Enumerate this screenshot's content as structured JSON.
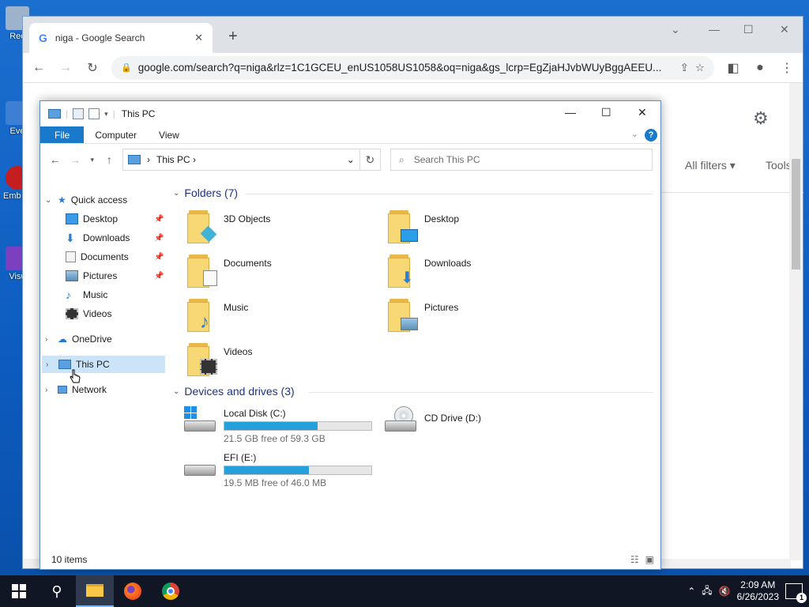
{
  "desktop": {
    "icons": [
      {
        "label": "Rec",
        "icon": "recycle-bin-icon",
        "color": "#7a8fa8"
      },
      {
        "label": "Eve",
        "icon": "app-shortcut-icon",
        "color": "#3d7fd4"
      },
      {
        "label": "Emb De",
        "icon": "app-shortcut-icon",
        "color": "#c41e1e"
      },
      {
        "label": "Visu",
        "icon": "visual-studio-icon",
        "color": "#7b3fbf"
      }
    ]
  },
  "chrome": {
    "tab_title": "niga - Google Search",
    "new_tab_glyph": "+",
    "address": "google.com/search?q=niga&rlz=1C1GCEU_enUS1058US1058&oq=niga&gs_lcrp=EgZjaHJvbWUyBggAEEU...",
    "page": {
      "all_filters": "All filters",
      "tools": "Tools"
    }
  },
  "explorer": {
    "title": "This PC",
    "ribbon_tabs": [
      "File",
      "Computer",
      "View"
    ],
    "help_glyph": "?",
    "breadcrumb": "This PC",
    "search_placeholder": "Search This PC",
    "nav": {
      "quick_access": "Quick access",
      "items": [
        "Desktop",
        "Downloads",
        "Documents",
        "Pictures",
        "Music",
        "Videos"
      ],
      "onedrive": "OneDrive",
      "this_pc": "This PC",
      "network": "Network"
    },
    "folders_header": "Folders (7)",
    "folders": [
      "3D Objects",
      "Desktop",
      "Documents",
      "Downloads",
      "Music",
      "Pictures",
      "Videos"
    ],
    "devices_header": "Devices and drives (3)",
    "drives": [
      {
        "name": "Local Disk (C:)",
        "free": "21.5 GB free of 59.3 GB",
        "used_fraction": 0.637
      },
      {
        "name": "CD Drive (D:)"
      },
      {
        "name": "EFI (E:)",
        "free": "19.5 MB free of 46.0 MB",
        "used_fraction": 0.576
      }
    ],
    "status": "10 items",
    "accent": "#1979ca",
    "bar_color": "#26a0da"
  },
  "taskbar": {
    "time": "2:09 AM",
    "date": "6/26/2023",
    "notifications": "1"
  }
}
